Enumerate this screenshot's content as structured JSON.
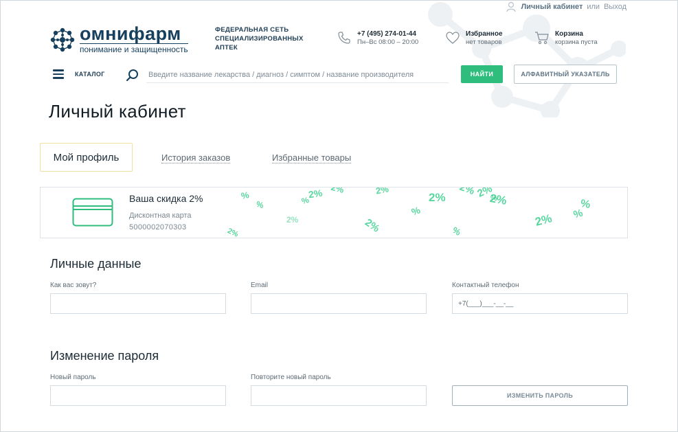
{
  "userbar": {
    "cabinet_label": "Личный кабинет",
    "or_label": "или",
    "logout_label": "Выход"
  },
  "logo": {
    "name": "омнифарм",
    "slogan": "понимание и защищенность"
  },
  "network": {
    "line1": "ФЕДЕРАЛЬНАЯ СЕТЬ",
    "line2": "СПЕЦИАЛИЗИРОВАННЫХ",
    "line3": "АПТЕК"
  },
  "contacts": {
    "phone": "+7 (495) 274-01-44",
    "hours": "Пн–Вс 08:00 – 20:00"
  },
  "favorites": {
    "title": "Избранное",
    "status": "нет товаров"
  },
  "cart": {
    "title": "Корзина",
    "status": "корзина пуста"
  },
  "nav": {
    "catalog_label": "КАТАЛОГ",
    "search_placeholder": "Введите название лекарства / диагноз / симптом / название производителя",
    "find_label": "НАЙТИ",
    "alphabet_label": "АЛФАВИТНЫЙ УКАЗАТЕЛЬ"
  },
  "page": {
    "title": "Личный кабинет"
  },
  "tabs": [
    {
      "label": "Мой профиль",
      "active": true
    },
    {
      "label": "История заказов",
      "active": false
    },
    {
      "label": "Избранные товары",
      "active": false
    }
  ],
  "discount": {
    "title": "Ваша скидка 2%",
    "card_label": "Дисконтная карта",
    "card_number": "5000002070303",
    "pattern_marks": [
      "%",
      "%",
      "2%",
      "%",
      "2%",
      "2%",
      "2%",
      "2%",
      "%",
      "2%",
      "2%",
      "2%",
      "2%",
      "%",
      "%",
      "2%",
      "%",
      "2%",
      "%"
    ]
  },
  "personal": {
    "title": "Личные данные",
    "name_label": "Как вас зовут?",
    "name_value": "",
    "email_label": "Email",
    "email_value": "",
    "phone_label": "Контактный телефон",
    "phone_placeholder": "+7(___)___-__-__"
  },
  "password": {
    "title": "Изменение пароля",
    "new_label": "Новый пароль",
    "repeat_label": "Повторите новый пароль",
    "change_label": "ИЗМЕНИТЬ ПАРОЛЬ"
  },
  "colors": {
    "brand": "#16405e",
    "accent_green": "#2ebd7d",
    "tab_border": "#f0e29c"
  },
  "icons": [
    "user-icon",
    "logo-molecule-icon",
    "phone-icon",
    "heart-icon",
    "cart-icon",
    "burger-menu-icon",
    "search-icon",
    "discount-card-icon"
  ]
}
